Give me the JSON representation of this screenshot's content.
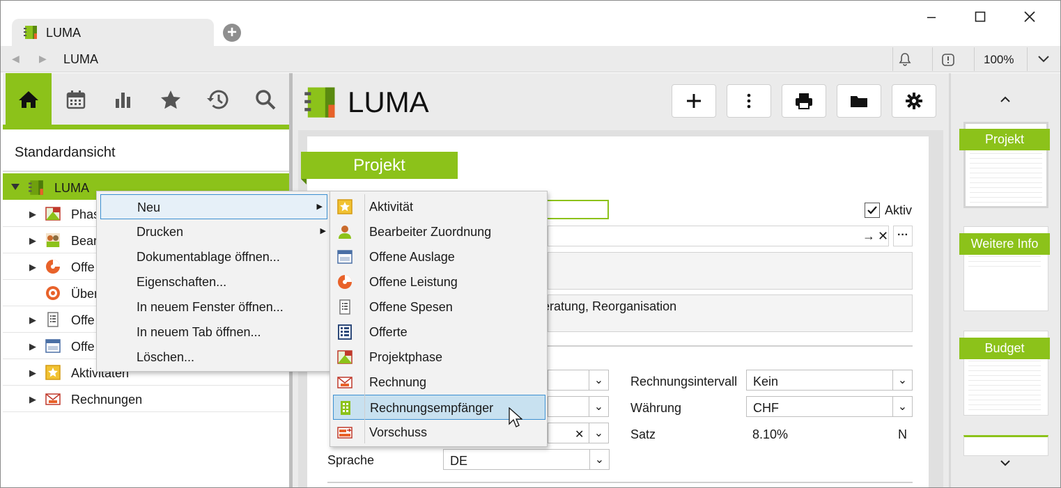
{
  "browser": {
    "tab_title": "LUMA",
    "address": "LUMA",
    "zoom": "100%"
  },
  "sidebar": {
    "view_title": "Standardansicht",
    "root_label": "LUMA",
    "items": [
      {
        "label": "Phas",
        "icon": "projektphase-icon"
      },
      {
        "label": "Bear",
        "icon": "bearbeiter-icon"
      },
      {
        "label": "Offe",
        "icon": "offene-leistung-icon"
      },
      {
        "label": "Über",
        "icon": "target-icon"
      },
      {
        "label": "Offe",
        "icon": "offene-spesen-icon"
      },
      {
        "label": "Offe",
        "icon": "offene-auslage-icon"
      },
      {
        "label": "Aktivitäten",
        "icon": "aktivitaet-icon"
      },
      {
        "label": "Rechnungen",
        "icon": "rechnung-icon"
      }
    ]
  },
  "main": {
    "title": "LUMA",
    "section_header": "Projekt",
    "aktiv_label": "Aktiv",
    "description_fragment": "eratung, Reorganisation",
    "rechnungsintervall_label": "Rechnungsintervall",
    "rechnungsintervall_value": "Kein",
    "waehrung_label": "Währung",
    "waehrung_value": "CHF",
    "satz_label": "Satz",
    "satz_value": "8.10%",
    "satz_suffix": "N",
    "sprache_label": "Sprache",
    "sprache_value": "DE"
  },
  "preview": {
    "cards": [
      "Projekt",
      "Weitere Info",
      "Budget"
    ]
  },
  "context_menu": {
    "items": [
      {
        "label": "Neu",
        "submenu": true
      },
      {
        "label": "Drucken",
        "submenu": true
      },
      {
        "label": "Dokumentablage öffnen..."
      },
      {
        "label": "Eigenschaften..."
      },
      {
        "label": "In neuem Fenster öffnen..."
      },
      {
        "label": "In neuem Tab öffnen..."
      },
      {
        "label": "Löschen..."
      }
    ]
  },
  "submenu": {
    "items": [
      {
        "label": "Aktivität",
        "icon": "aktivitaet-icon"
      },
      {
        "label": "Bearbeiter Zuordnung",
        "icon": "bearbeiter-zuordnung-icon"
      },
      {
        "label": "Offene Auslage",
        "icon": "offene-auslage-icon"
      },
      {
        "label": "Offene Leistung",
        "icon": "offene-leistung-icon"
      },
      {
        "label": "Offene Spesen",
        "icon": "offene-spesen-icon"
      },
      {
        "label": "Offerte",
        "icon": "offerte-icon"
      },
      {
        "label": "Projektphase",
        "icon": "projektphase-icon"
      },
      {
        "label": "Rechnung",
        "icon": "rechnung-icon"
      },
      {
        "label": "Rechnungsempfänger",
        "icon": "rechnungsempfaenger-icon"
      },
      {
        "label": "Vorschuss",
        "icon": "vorschuss-icon"
      }
    ]
  },
  "colors": {
    "accent": "#8cc21a",
    "highlight": "#c8e1f0",
    "highlight_border": "#3b8fd1"
  }
}
